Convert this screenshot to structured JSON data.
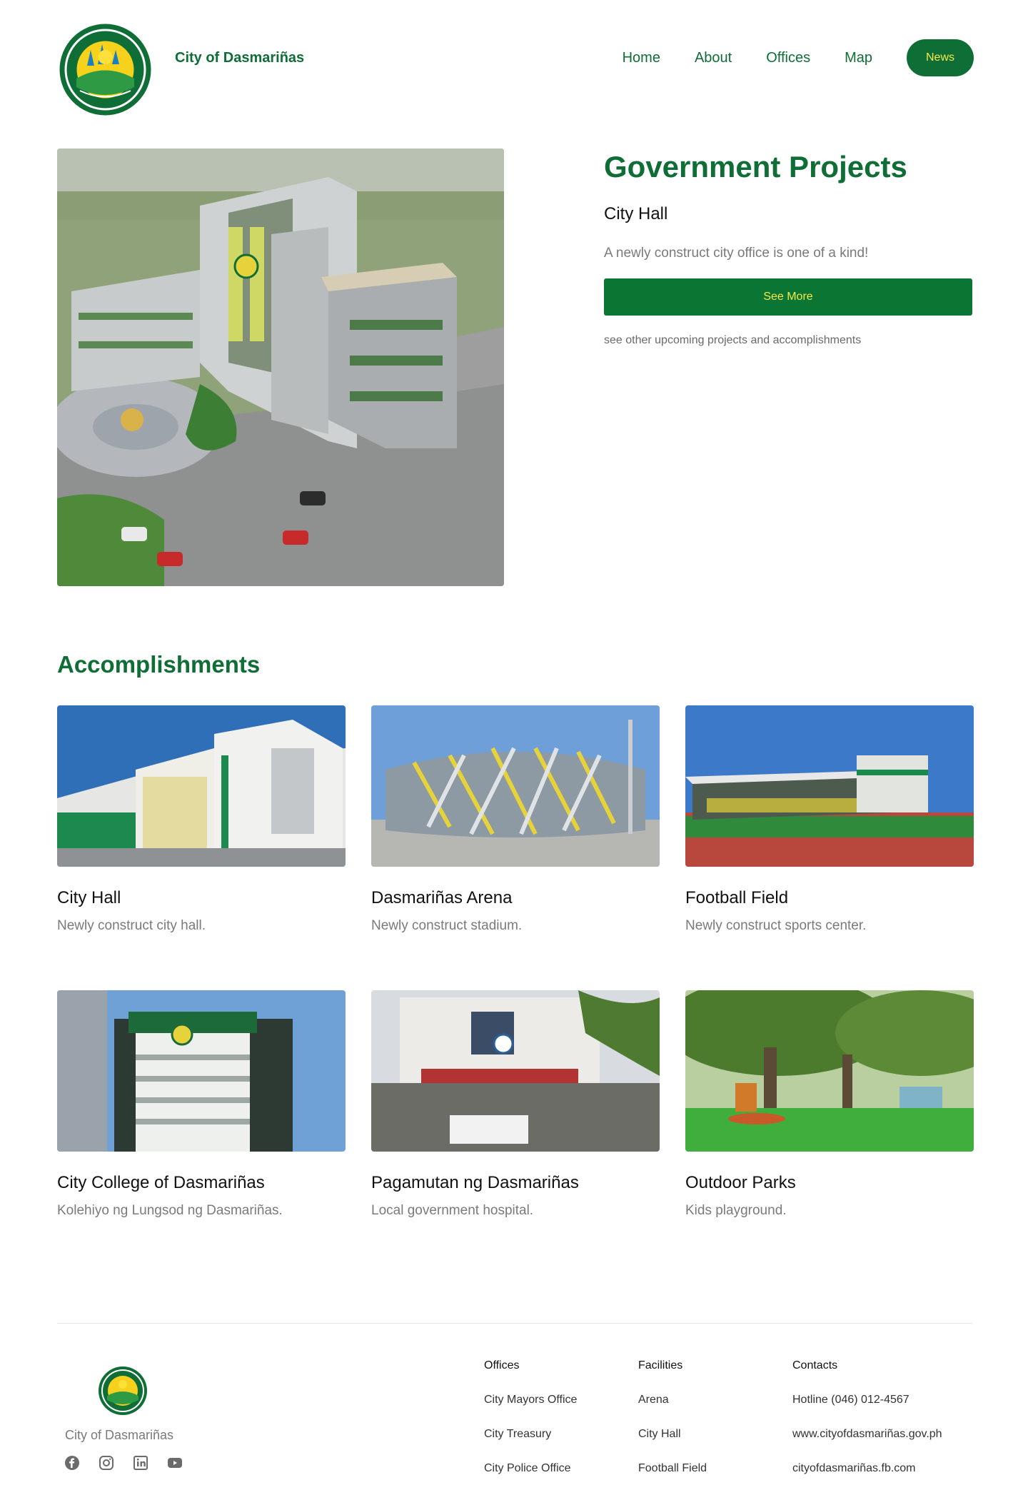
{
  "header": {
    "brand": "City of Dasmariñas",
    "logo_text_top": "CITY OF DASMARIÑAS",
    "logo_text_bottom": "PROVINCE OF CAVITE",
    "nav": [
      "Home",
      "About",
      "Offices",
      "Map"
    ],
    "news": "News"
  },
  "hero": {
    "title": "Government Projects",
    "subtitle": "City Hall",
    "description": "A newly construct city office is one of a kind!",
    "button": "See More",
    "note": "see other upcoming projects and accomplishments"
  },
  "accomplishments": {
    "title": "Accomplishments",
    "cards": [
      {
        "title": "City Hall",
        "desc": "Newly construct city hall."
      },
      {
        "title": "Dasmariñas Arena",
        "desc": "Newly construct stadium."
      },
      {
        "title": "Football Field",
        "desc": "Newly construct sports center."
      },
      {
        "title": "City College of Dasmariñas",
        "desc": "Kolehiyo ng Lungsod ng Dasmariñas."
      },
      {
        "title": "Pagamutan ng Dasmariñas",
        "desc": "Local government hospital."
      },
      {
        "title": "Outdoor Parks",
        "desc": "Kids playground."
      }
    ]
  },
  "footer": {
    "brand": "City of Dasmariñas",
    "social": [
      "facebook-icon",
      "instagram-icon",
      "linkedin-icon",
      "youtube-icon"
    ],
    "columns": [
      {
        "heading": "Offices",
        "links": [
          "City Mayors Office",
          "City Treasury",
          "City Police Office"
        ]
      },
      {
        "heading": "Facilities",
        "links": [
          "Arena",
          "City Hall",
          "Football Field"
        ]
      },
      {
        "heading": "Contacts",
        "links": [
          "Hotline (046) 012-4567",
          "www.cityofdasmariñas.gov.ph",
          "cityofdasmariñas.fb.com"
        ]
      }
    ]
  },
  "colors": {
    "brand_green": "#0f6e35",
    "accent_yellow": "#f5e94a",
    "muted_text": "#7a7a7a"
  }
}
